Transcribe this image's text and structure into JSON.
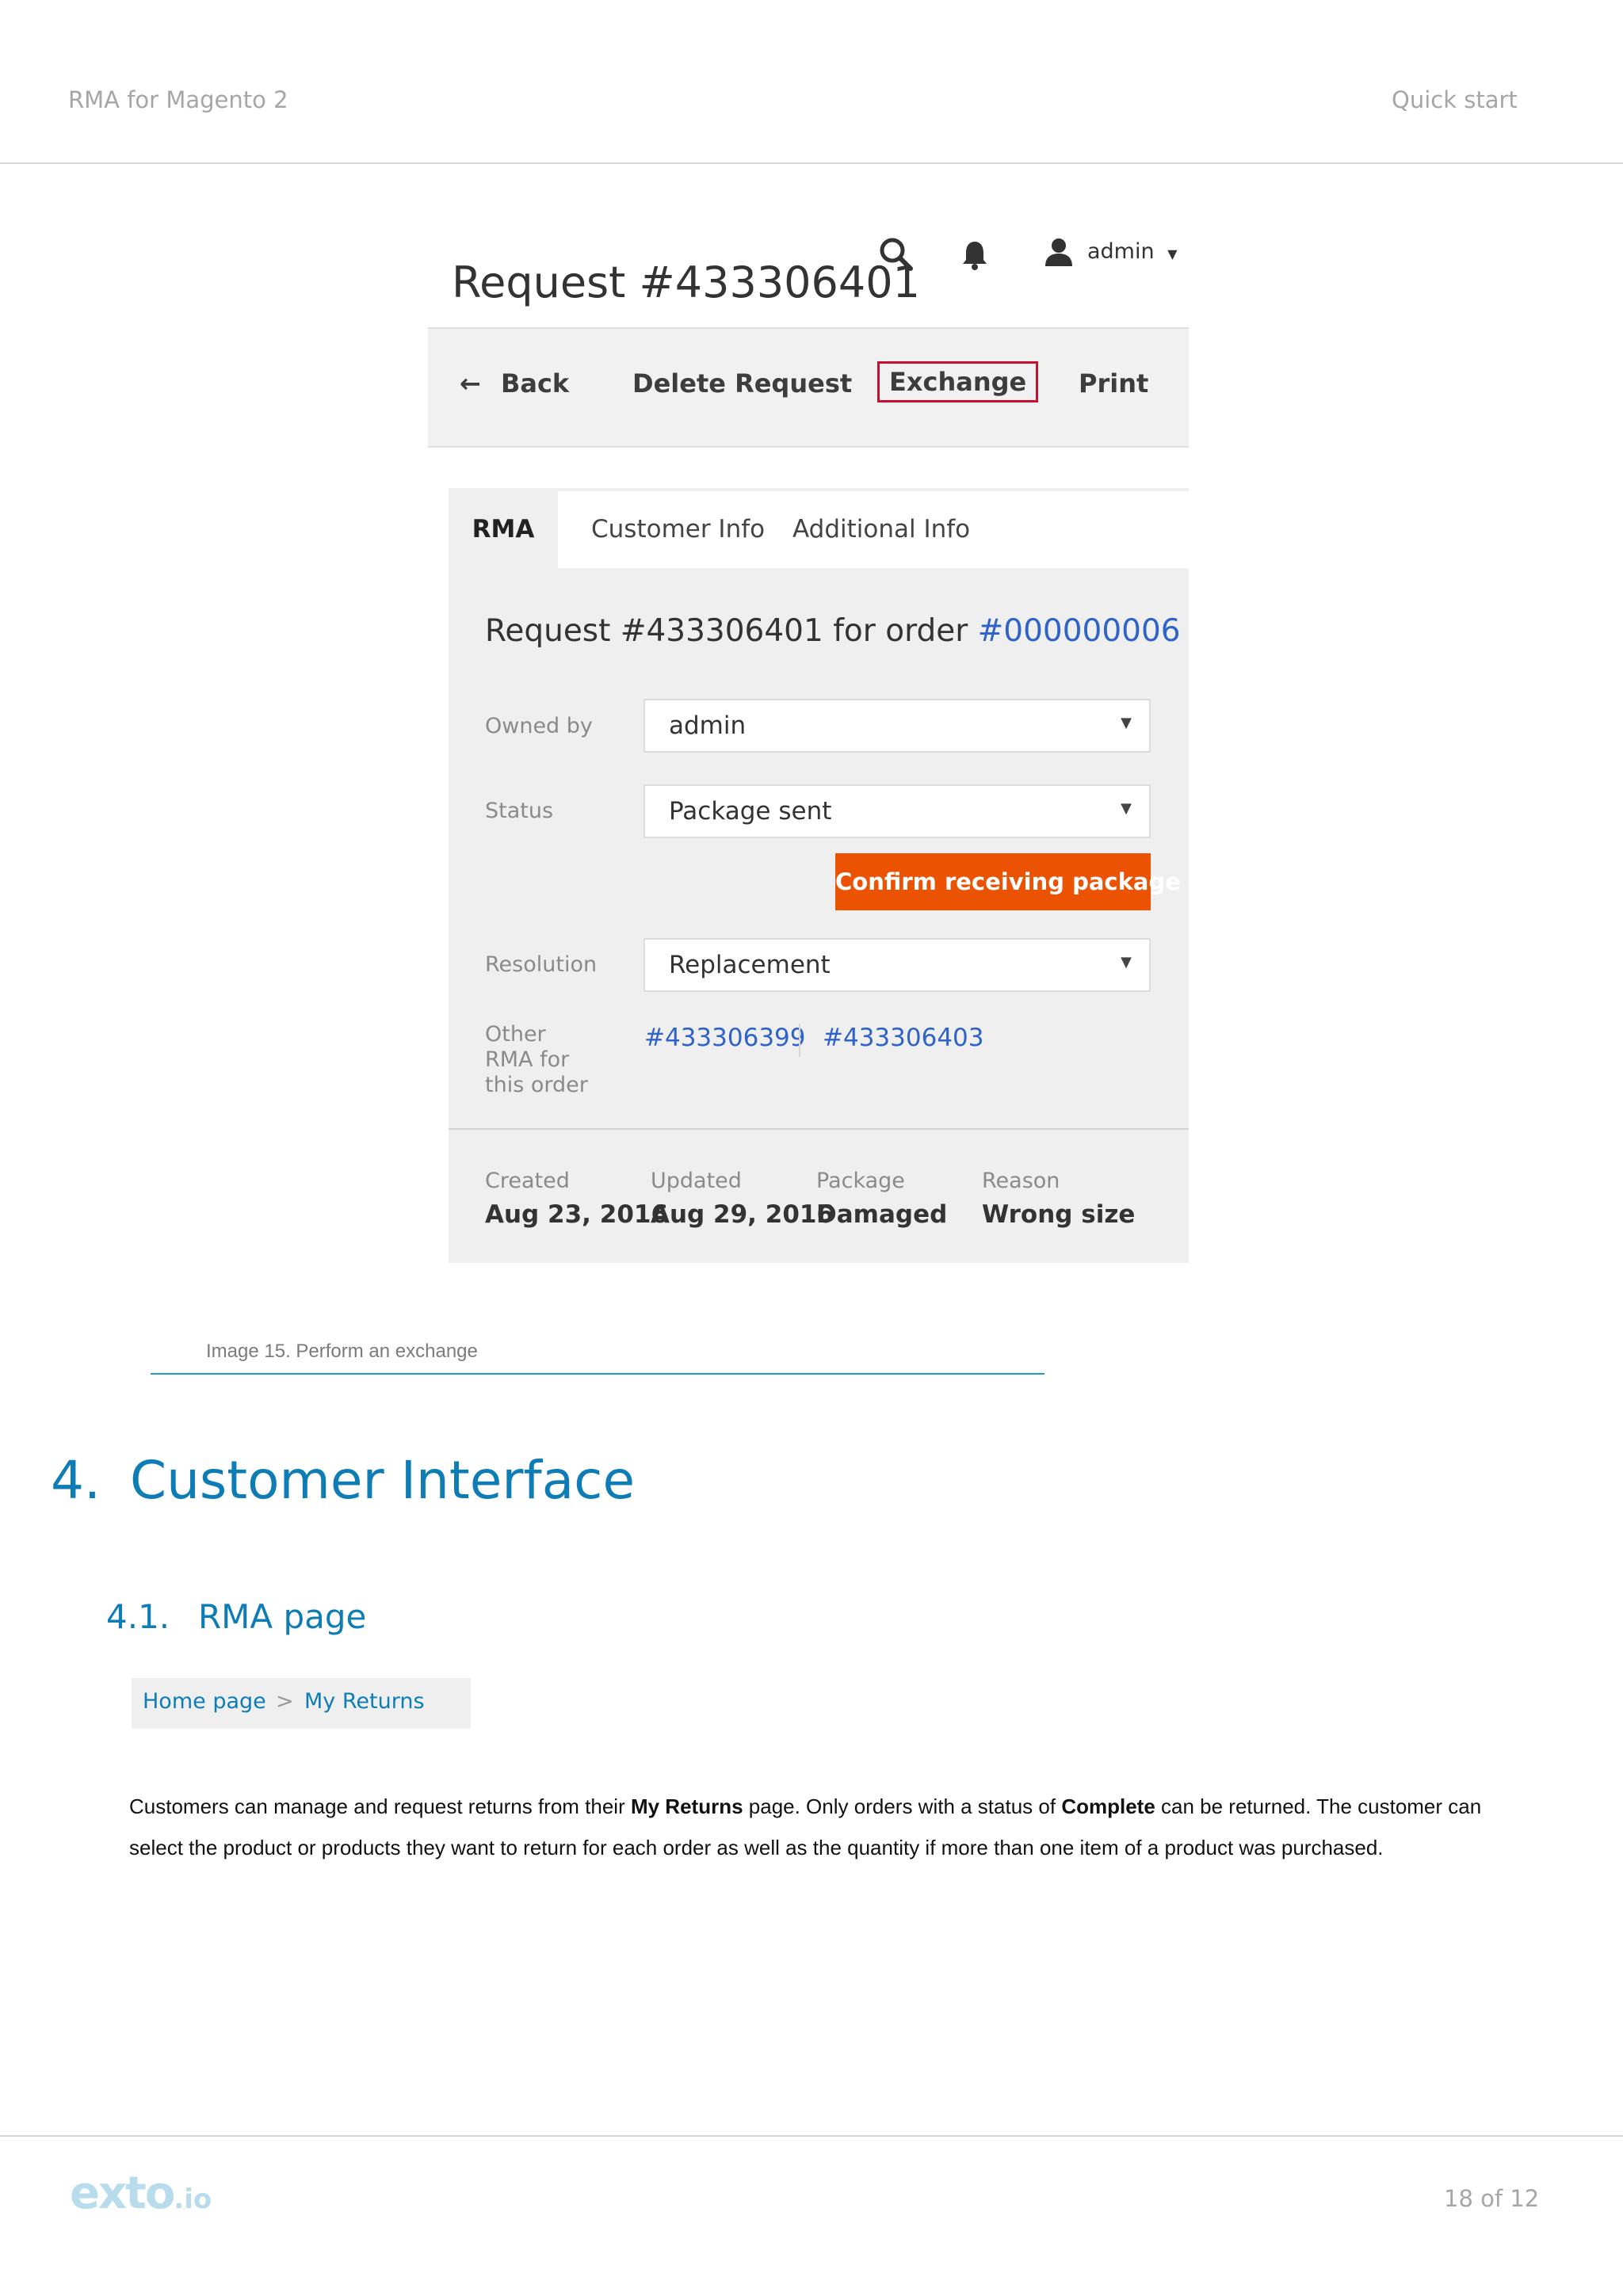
{
  "header": {
    "left": "RMA for Magento 2",
    "right": "Quick start"
  },
  "screenshot": {
    "title": "Request #433306401",
    "top_icons": {
      "search": "search-icon",
      "bell": "bell-icon",
      "user": "user-icon"
    },
    "user_label": "admin",
    "toolbar": {
      "back_arrow": "←",
      "back": "Back",
      "delete": "Delete Request",
      "exchange": "Exchange",
      "print": "Print"
    },
    "tabs": [
      "RMA",
      "Customer Info",
      "Additional Info"
    ],
    "panel_title_prefix": "Request #433306401 for order ",
    "panel_title_order": "#000000006",
    "fields": {
      "owned_by_label": "Owned by",
      "owned_by_value": "admin",
      "status_label": "Status",
      "status_value": "Package sent",
      "confirm_button": "Confirm receiving package",
      "resolution_label": "Resolution",
      "resolution_value": "Replacement",
      "other_rma_label": [
        "Other",
        "RMA for",
        "this order"
      ],
      "other_rma_links": [
        "#433306399",
        "#433306403"
      ]
    },
    "meta": [
      {
        "label": "Created",
        "value": "Aug 23, 2016"
      },
      {
        "label": "Updated",
        "value": "Aug 29, 2016"
      },
      {
        "label": "Package",
        "value": "Damaged"
      },
      {
        "label": "Reason",
        "value": "Wrong size"
      }
    ],
    "accent_color": "#eb5202",
    "link_color": "#2f63c8"
  },
  "caption": "Image 15. Perform an exchange",
  "section": {
    "number": "4.",
    "title": "Customer Interface"
  },
  "subsection": {
    "number": "4.1.",
    "title": "RMA page"
  },
  "breadcrumb": {
    "home": "Home page",
    "separator": ">",
    "current": "My Returns"
  },
  "paragraph": {
    "part1": "Customers can manage and request returns from their ",
    "bold1": "My Returns",
    "part2": " page. Only orders with a status of ",
    "bold2": "Complete",
    "part3": " can be returned. The customer can select the product or products they want to return for each order as well as the quantity if more than one item of a product was purchased."
  },
  "footer": {
    "logo_main": "exto",
    "logo_suffix": ".io",
    "page": "18 of 12"
  },
  "colors": {
    "heading": "#0e7db5",
    "caption_rule": "#1aa3b8",
    "muted": "#a6a6a6"
  }
}
